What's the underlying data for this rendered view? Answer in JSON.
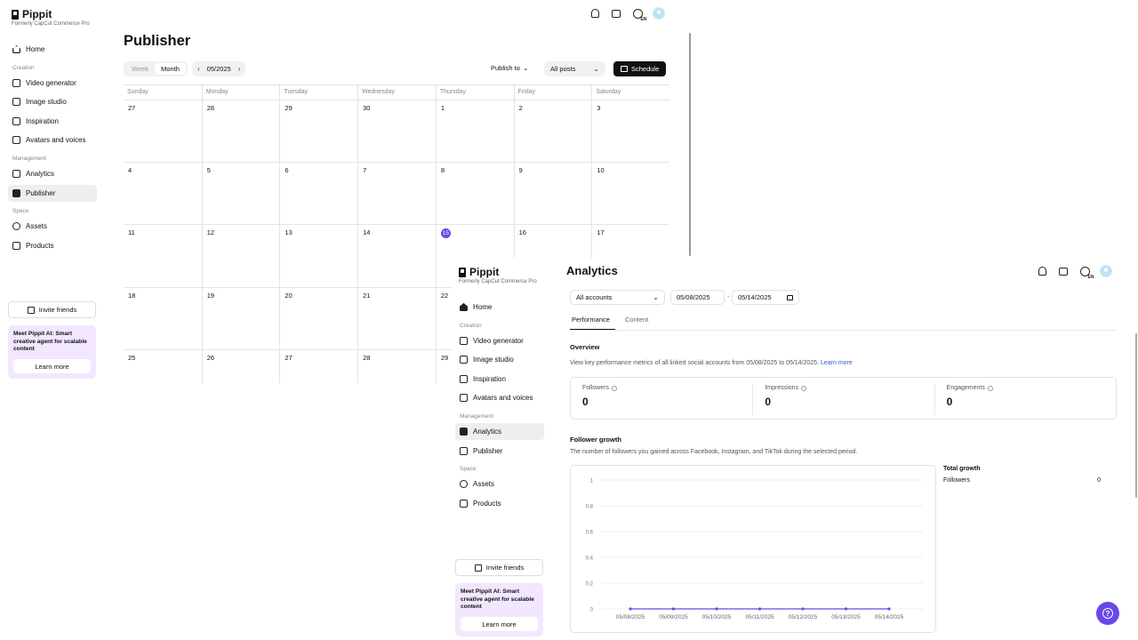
{
  "brand": {
    "name": "Pippit",
    "subtitle": "Formerly CapCut Commerce Pro"
  },
  "sidebar": {
    "home": "Home",
    "creation_head": "Creation",
    "creation": [
      "Video generator",
      "Image studio",
      "Inspiration",
      "Avatars and voices"
    ],
    "management_head": "Management",
    "analytics": "Analytics",
    "publisher": "Publisher",
    "space_head": "Space",
    "assets": "Assets",
    "products": "Products",
    "invite": "Invite friends",
    "promo_text": "Meet Pippit AI: Smart creative agent for scalable content",
    "promo_button": "Learn more"
  },
  "topbar": {
    "icons": [
      "bell-icon",
      "inbox-icon",
      "globe-icon",
      "avatar"
    ],
    "lang": "EN"
  },
  "publisher": {
    "title": "Publisher",
    "view_week": "Week",
    "view_month": "Month",
    "month": "05/2025",
    "publish_to": "Publish to",
    "filter": "All posts",
    "schedule": "Schedule",
    "weekdays": [
      "Sunday",
      "Monday",
      "Tuesday",
      "Wednesday",
      "Thursday",
      "Friday",
      "Saturday"
    ],
    "weeks": [
      [
        "27",
        "28",
        "29",
        "30",
        "1",
        "2",
        "3"
      ],
      [
        "4",
        "5",
        "6",
        "7",
        "8",
        "9",
        "10"
      ],
      [
        "11",
        "12",
        "13",
        "14",
        "15",
        "16",
        "17"
      ],
      [
        "18",
        "19",
        "20",
        "21",
        "22",
        "",
        ""
      ],
      [
        "25",
        "26",
        "27",
        "28",
        "29",
        "",
        ""
      ]
    ],
    "today": "15"
  },
  "analytics": {
    "title": "Analytics",
    "accounts": "All accounts",
    "start_date": "05/08/2025",
    "end_date": "05/14/2025",
    "date_sep": "-",
    "tabs": [
      "Performance",
      "Content"
    ],
    "overview_title": "Overview",
    "overview_desc": "View key performance metrics of all linked social accounts from 05/08/2025 to 05/14/2025.",
    "learn_more": "Learn more",
    "stats": [
      {
        "label": "Followers",
        "value": "0"
      },
      {
        "label": "Impressions",
        "value": "0"
      },
      {
        "label": "Engagements",
        "value": "0"
      }
    ],
    "growth_title": "Follower growth",
    "growth_desc": "The number of followers you gained across Facebook, Instagram, and TikTok during the selected period.",
    "total_growth": "Total growth",
    "total_label": "Followers",
    "total_value": "0"
  },
  "chart_data": {
    "type": "line",
    "x": [
      "05/08/2025",
      "05/09/2025",
      "05/10/2025",
      "05/11/2025",
      "05/12/2025",
      "05/13/2025",
      "05/14/2025"
    ],
    "series": [
      {
        "values": [
          0,
          0,
          0,
          0,
          0,
          0,
          0
        ]
      }
    ],
    "yticks": [
      "0",
      "0.2",
      "0.4",
      "0.6",
      "0.8",
      "1"
    ],
    "ylim": [
      0,
      1
    ],
    "grid": true,
    "color": "#6a47e8"
  }
}
